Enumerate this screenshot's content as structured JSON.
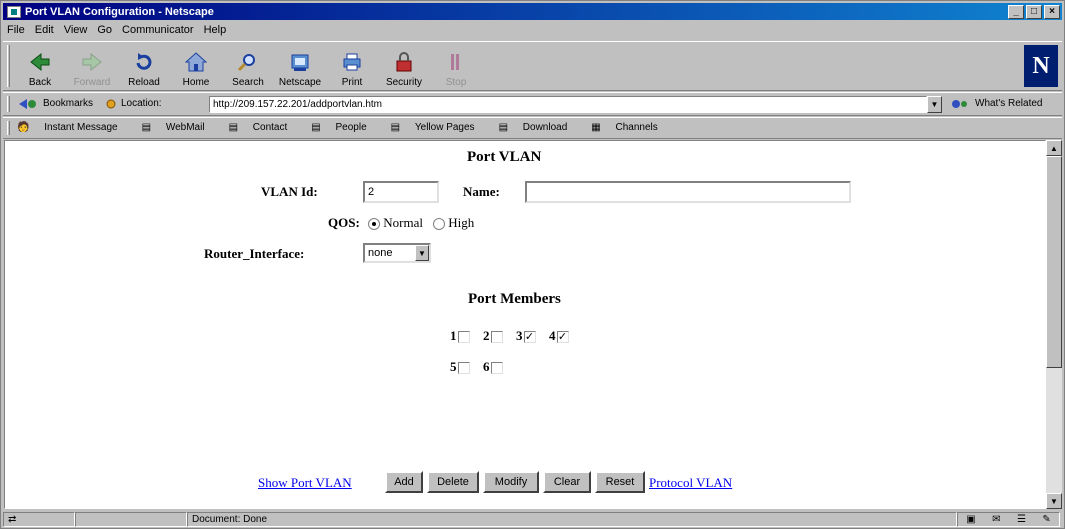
{
  "window": {
    "title": "Port VLAN Configuration - Netscape",
    "min_glyph": "_",
    "max_glyph": "□",
    "close_glyph": "×"
  },
  "menu": [
    "File",
    "Edit",
    "View",
    "Go",
    "Communicator",
    "Help"
  ],
  "nav": [
    {
      "label": "Back",
      "icon": "back-arrow-icon",
      "enabled": true
    },
    {
      "label": "Forward",
      "icon": "forward-arrow-icon",
      "enabled": false
    },
    {
      "label": "Reload",
      "icon": "reload-icon",
      "enabled": true
    },
    {
      "label": "Home",
      "icon": "home-icon",
      "enabled": true
    },
    {
      "label": "Search",
      "icon": "search-icon",
      "enabled": true
    },
    {
      "label": "Netscape",
      "icon": "netscape-icon",
      "enabled": true
    },
    {
      "label": "Print",
      "icon": "print-icon",
      "enabled": true
    },
    {
      "label": "Security",
      "icon": "security-lock-icon",
      "enabled": true
    },
    {
      "label": "Stop",
      "icon": "stop-icon",
      "enabled": false
    }
  ],
  "logo": "N",
  "location": {
    "bookmarks": "Bookmarks",
    "label": "Location:",
    "url": "http://209.157.22.201/addportvlan.htm",
    "related": "What's Related"
  },
  "personal": [
    "Instant Message",
    "WebMail",
    "Contact",
    "People",
    "Yellow Pages",
    "Download",
    "Channels"
  ],
  "form": {
    "title": "Port VLAN",
    "vlan_id_label": "VLAN Id:",
    "vlan_id_value": "2",
    "name_label": "Name:",
    "name_value": "",
    "qos_label": "QOS:",
    "qos_options": [
      "Normal",
      "High"
    ],
    "qos_selected": "Normal",
    "router_label": "Router_Interface:",
    "router_value": "none",
    "members_title": "Port Members",
    "ports": [
      {
        "n": "1",
        "checked": false
      },
      {
        "n": "2",
        "checked": false
      },
      {
        "n": "3",
        "checked": true
      },
      {
        "n": "4",
        "checked": true
      },
      {
        "n": "5",
        "checked": false
      },
      {
        "n": "6",
        "checked": false
      }
    ],
    "show_link": "Show Port VLAN",
    "buttons": [
      "Add",
      "Delete",
      "Modify",
      "Clear",
      "Reset"
    ],
    "protocol_link": "Protocol VLAN"
  },
  "status": {
    "text": "Document: Done"
  }
}
